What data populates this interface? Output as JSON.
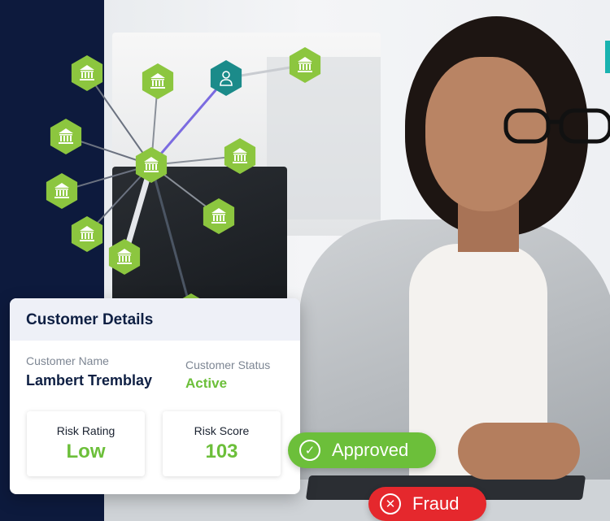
{
  "card": {
    "title": "Customer Details",
    "customer_name_label": "Customer Name",
    "customer_name": "Lambert Tremblay",
    "customer_status_label": "Customer Status",
    "customer_status": "Active",
    "risk_rating_label": "Risk Rating",
    "risk_rating": "Low",
    "risk_score_label": "Risk Score",
    "risk_score": "103"
  },
  "badges": {
    "approved": "Approved",
    "fraud": "Fraud"
  },
  "colors": {
    "background": "#0d1a3d",
    "node_green": "#8cc63f",
    "node_teal": "#1b8b8a",
    "approved_green": "#6cbf3a",
    "fraud_red": "#e5282d"
  },
  "graph": {
    "icons": [
      "bank-icon",
      "person-icon"
    ]
  }
}
